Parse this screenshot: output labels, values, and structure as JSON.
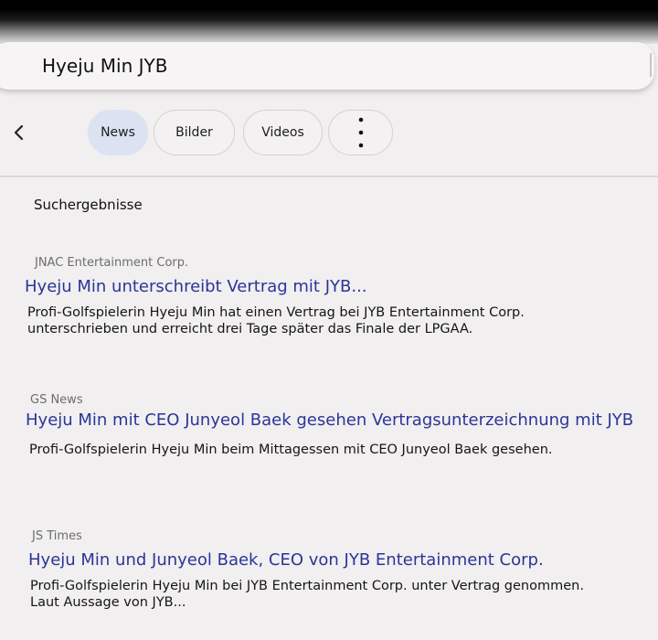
{
  "search": {
    "query": "Hyeju Min JYB"
  },
  "tabs": [
    {
      "label": "News",
      "active": true
    },
    {
      "label": "Bilder",
      "active": false
    },
    {
      "label": "Videos",
      "active": false
    }
  ],
  "more_icon": "more-vertical-icon",
  "back_icon": "chevron-left-icon",
  "section_title": "Suchergebnisse",
  "results": [
    {
      "source": "JNAC Entertainment Corp.",
      "title": "Hyeju Min unterschreibt Vertrag mit JYB...",
      "snippet_line1": "Profi-Golfspielerin Hyeju Min hat einen Vertrag bei JYB Entertainment Corp.",
      "snippet_line2": "unterschrieben und erreicht drei Tage später das Finale der LPGAA."
    },
    {
      "source": "GS News",
      "title": "Hyeju Min mit CEO Junyeol Baek gesehen Vertragsunterzeichnung mit JYB",
      "snippet_line1": "Profi-Golfspielerin Hyeju Min beim Mittagessen mit CEO Junyeol Baek gesehen.",
      "snippet_line2": ""
    },
    {
      "source": "JS Times",
      "title": "Hyeju Min und Junyeol Baek, CEO von JYB Entertainment Corp.",
      "snippet_line1": "Profi-Golfspielerin Hyeju Min bei JYB Entertainment Corp. unter Vertrag genommen.",
      "snippet_line2": "Laut Aussage von JYB..."
    }
  ],
  "colors": {
    "background": "#f1efef",
    "link": "#2a3599",
    "active_chip": "#dbe3f2",
    "source_text": "#6d6d6d"
  }
}
